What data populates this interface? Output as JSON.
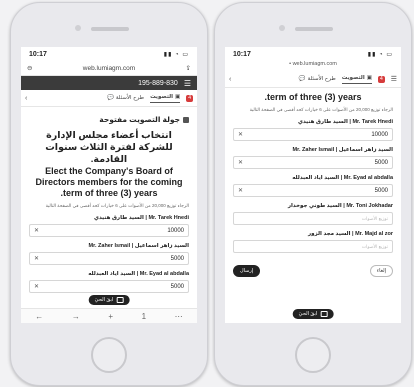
{
  "left": {
    "status": {
      "time": "10:17",
      "signal": "▮▮ ◔ ▭"
    },
    "url": {
      "text": "web.lumiagm.com"
    },
    "phone_number": "195-889-830",
    "tabs": [
      {
        "label": "التصويت",
        "badge": "4"
      },
      {
        "label": "طرح الأسئلة"
      }
    ],
    "section": "جولة التصويت مفتوحة",
    "title_ar": "انتخاب أعضاء مجلس الإدارة للشركة لفترة الثلاث سنوات القادمة.",
    "title_en": "Elect the Company's Board of Directors members for the coming .term of three (3) years",
    "hint": "الرجاء توزيع 20,000 من الأصوات على 6 خيارات كحد أقصى في الصفحة التالية",
    "candidates": [
      {
        "label": "Mr. Tarek Hnedi | السيد طارق هنيدي",
        "value": "10000"
      },
      {
        "label": "السيد زاهر اسماعيل | Mr. Zaher Ismail",
        "value": "5000"
      },
      {
        "label": "Mr. Eyad al abdalla | السيد اياد العبدلله",
        "value": "5000"
      }
    ],
    "stop_label": "ابقَ الحيَ",
    "nav": [
      "←",
      "→",
      "+",
      "1",
      "⋯"
    ]
  },
  "right": {
    "status": {
      "time": "10:17",
      "signal": "▮▮ ◔ ▭"
    },
    "url": {
      "text": "web.lumiagm.com"
    },
    "tabs": [
      {
        "label": "التصويت",
        "badge": "4"
      },
      {
        "label": "طرح الأسئلة"
      }
    ],
    "title_en": ".term of three (3) years",
    "hint": "الرجاء توزيع 20,000 من الأصوات على 6 خيارات كحد أقصى في الصفحة التالية",
    "candidates": [
      {
        "label": "Mr. Tarek Hnedi | السيد طارق هنيدي",
        "value": "10000",
        "placeholder": ""
      },
      {
        "label": "السيد زاهر اسماعيل | Mr. Zaher Ismail",
        "value": "5000",
        "placeholder": ""
      },
      {
        "label": "Mr. Eyad al abdalla | السيد اياد العبدلله",
        "value": "5000",
        "placeholder": ""
      },
      {
        "label": "Mr. Toni Jokhadar | السيد طوني جوخدار",
        "value": "",
        "placeholder": "توزيع الأصوات"
      },
      {
        "label": "Mr. Majd al zor | السيد مجد الزور",
        "value": "",
        "placeholder": "توزيع الأصوات"
      }
    ],
    "submit_label": "إرسال",
    "cancel_label": "إلغاء",
    "stop_label": "ابقَ الحيَ"
  }
}
